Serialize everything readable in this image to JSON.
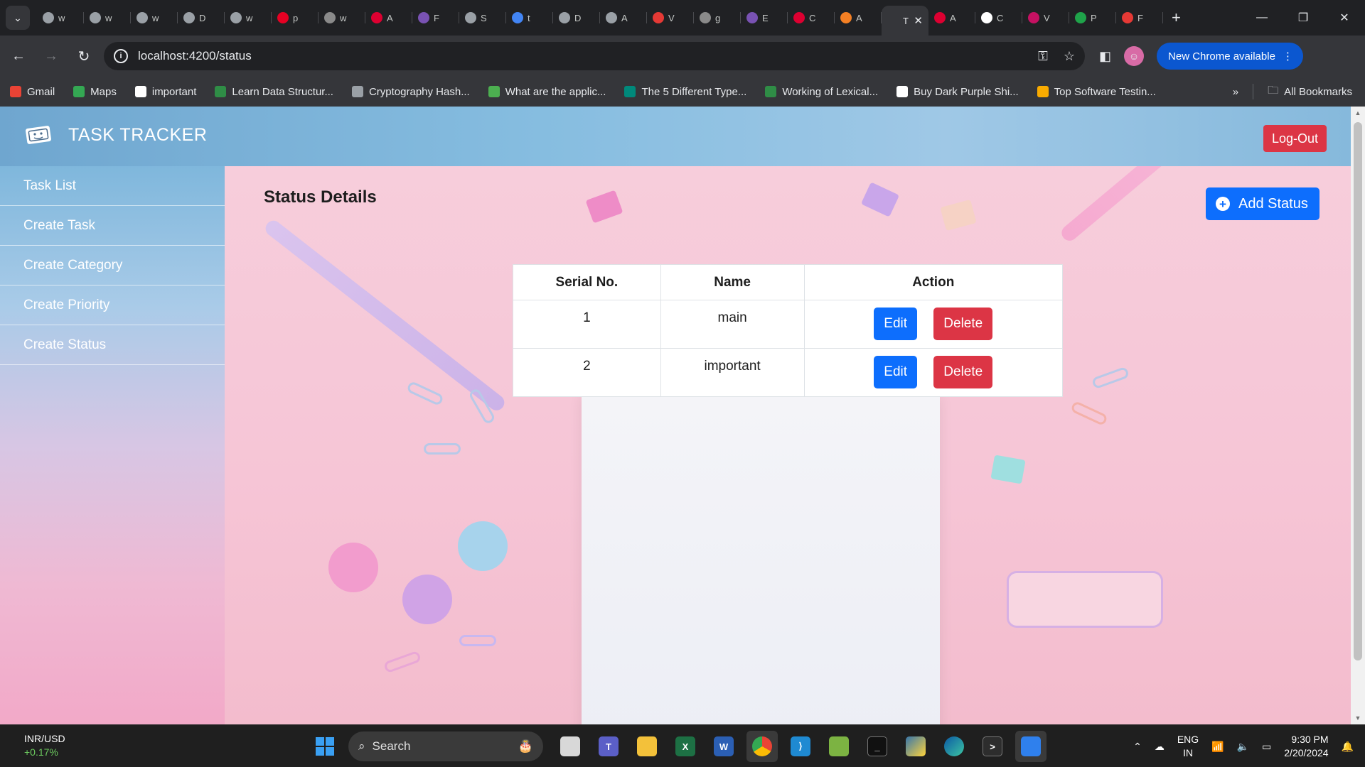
{
  "browser": {
    "tabs": [
      {
        "letter": "w",
        "color": "#9aa0a6"
      },
      {
        "letter": "w",
        "color": "#9aa0a6"
      },
      {
        "letter": "w",
        "color": "#9aa0a6"
      },
      {
        "letter": "D",
        "color": "#9aa0a6"
      },
      {
        "letter": "w",
        "color": "#9aa0a6"
      },
      {
        "letter": "p",
        "color": "#e60023"
      },
      {
        "letter": "w",
        "color": "#8a8a8a"
      },
      {
        "letter": "A",
        "color": "#dd0031"
      },
      {
        "letter": "F",
        "color": "#7952b3"
      },
      {
        "letter": "S",
        "color": "#9aa0a6"
      },
      {
        "letter": "t",
        "color": "#4285f4"
      },
      {
        "letter": "D",
        "color": "#9aa0a6"
      },
      {
        "letter": "A",
        "color": "#9aa0a6"
      },
      {
        "letter": "V",
        "color": "#e53935"
      },
      {
        "letter": "g",
        "color": "#8a8a8a"
      },
      {
        "letter": "E",
        "color": "#7952b3"
      },
      {
        "letter": "C",
        "color": "#dd0031"
      },
      {
        "letter": "A",
        "color": "#f48024"
      },
      {
        "letter": "T",
        "color": "#35363a",
        "active": true
      },
      {
        "letter": "A",
        "color": "#dd0031"
      },
      {
        "letter": "C",
        "color": "#ffffff"
      },
      {
        "letter": "V",
        "color": "#c51162"
      },
      {
        "letter": "P",
        "color": "#1fa34a"
      },
      {
        "letter": "F",
        "color": "#e53935"
      }
    ],
    "url": "localhost:4200/status",
    "update_label": "New Chrome available",
    "bookmarks": [
      {
        "label": "Gmail",
        "icon": "gmail-icon",
        "color": "#ea4335"
      },
      {
        "label": "Maps",
        "icon": "maps-icon",
        "color": "#34a853"
      },
      {
        "label": "important",
        "icon": "google-icon",
        "color": "#ffffff"
      },
      {
        "label": "Learn Data Structur...",
        "icon": "gfg-icon",
        "color": "#2f8d46"
      },
      {
        "label": "Cryptography Hash...",
        "icon": "globe-icon",
        "color": "#9aa0a6"
      },
      {
        "label": "What are the applic...",
        "icon": "site-icon",
        "color": "#4caf50"
      },
      {
        "label": "The 5 Different Type...",
        "icon": "site-icon",
        "color": "#00897b"
      },
      {
        "label": "Working of Lexical...",
        "icon": "gfg-icon",
        "color": "#2f8d46"
      },
      {
        "label": "Buy Dark Purple Shi...",
        "icon": "triangle-icon",
        "color": "#ffffff"
      },
      {
        "label": "Top Software Testin...",
        "icon": "mountain-icon",
        "color": "#f9ab00"
      }
    ],
    "all_bookmarks": "All Bookmarks"
  },
  "app": {
    "brand": "TASK TRACKER",
    "logout": "Log-Out",
    "sidebar": [
      {
        "label": "Task List"
      },
      {
        "label": "Create Task"
      },
      {
        "label": "Create Category"
      },
      {
        "label": "Create Priority"
      },
      {
        "label": "Create Status"
      }
    ],
    "title": "Status Details",
    "add_button": "Add Status",
    "table": {
      "headers": [
        "Serial No.",
        "Name",
        "Action"
      ],
      "rows": [
        {
          "serial": "1",
          "name": "main"
        },
        {
          "serial": "2",
          "name": "important"
        }
      ],
      "edit_label": "Edit",
      "delete_label": "Delete"
    },
    "colors": {
      "primary": "#0d6efd",
      "danger": "#dc3545"
    }
  },
  "taskbar": {
    "ticker_label": "INR/USD",
    "ticker_change": "+0.17%",
    "search": "Search",
    "lang_top": "ENG",
    "lang_bottom": "IN",
    "time": "9:30 PM",
    "date": "2/20/2024"
  }
}
